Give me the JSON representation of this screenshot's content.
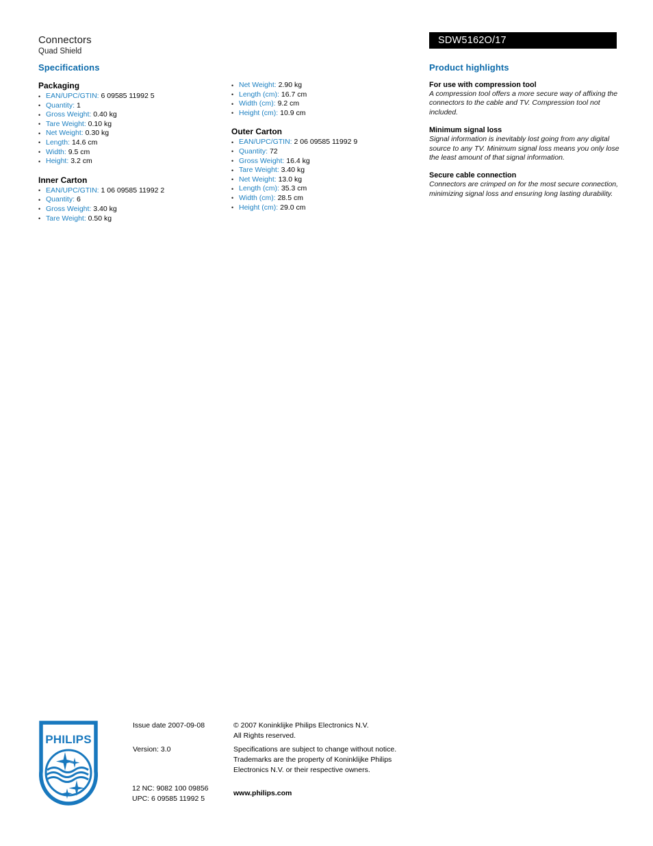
{
  "header": {
    "title": "Connectors",
    "subtitle": "Quad Shield",
    "model": "SDW5162O/17"
  },
  "specifications": {
    "heading": "Specifications",
    "groups": [
      {
        "title": "Packaging",
        "column": "left",
        "items": [
          {
            "label": "EAN/UPC/GTIN:",
            "value": "6 09585 11992 5"
          },
          {
            "label": "Quantity:",
            "value": "1"
          },
          {
            "label": "Gross Weight:",
            "value": "0.40 kg"
          },
          {
            "label": "Tare Weight:",
            "value": "0.10 kg"
          },
          {
            "label": "Net Weight:",
            "value": "0.30 kg"
          },
          {
            "label": "Length:",
            "value": "14.6 cm"
          },
          {
            "label": "Width:",
            "value": "9.5 cm"
          },
          {
            "label": "Height:",
            "value": "3.2 cm"
          }
        ]
      },
      {
        "title": "Inner Carton",
        "column": "left",
        "items": [
          {
            "label": "EAN/UPC/GTIN:",
            "value": "1 06 09585 11992 2"
          },
          {
            "label": "Quantity:",
            "value": "6"
          },
          {
            "label": "Gross Weight:",
            "value": "3.40 kg"
          },
          {
            "label": "Tare Weight:",
            "value": "0.50 kg"
          }
        ]
      },
      {
        "title": "",
        "column": "middle",
        "items": [
          {
            "label": "Net Weight:",
            "value": "2.90 kg"
          },
          {
            "label": "Length (cm):",
            "value": "16.7 cm"
          },
          {
            "label": "Width (cm):",
            "value": "9.2 cm"
          },
          {
            "label": "Height (cm):",
            "value": "10.9 cm"
          }
        ]
      },
      {
        "title": "Outer Carton",
        "column": "middle",
        "items": [
          {
            "label": "EAN/UPC/GTIN:",
            "value": "2 06 09585 11992 9"
          },
          {
            "label": "Quantity:",
            "value": "72"
          },
          {
            "label": "Gross Weight:",
            "value": "16.4 kg"
          },
          {
            "label": "Tare Weight:",
            "value": "3.40 kg"
          },
          {
            "label": "Net Weight:",
            "value": "13.0 kg"
          },
          {
            "label": "Length (cm):",
            "value": "35.3 cm"
          },
          {
            "label": "Width (cm):",
            "value": "28.5 cm"
          },
          {
            "label": "Height (cm):",
            "value": "29.0 cm"
          }
        ]
      }
    ]
  },
  "highlights": {
    "heading": "Product highlights",
    "items": [
      {
        "title": "For use with compression tool",
        "body": "A compression tool offers a more secure way of affixing the connectors to the cable and TV. Compression tool not included."
      },
      {
        "title": "Minimum signal loss",
        "body": "Signal information is inevitably lost going from any digital source to any TV. Minimum signal loss means you only lose the least amount of that signal information."
      },
      {
        "title": "Secure cable connection",
        "body": "Connectors are crimped on for the most secure connection, minimizing signal loss and ensuring long lasting durability."
      }
    ]
  },
  "footer": {
    "logo_text": "PHILIPS",
    "issue_date": "Issue date 2007-09-08",
    "version": "Version: 3.0",
    "twelve_nc": "12 NC: 9082 100 09856",
    "upc": "UPC: 6 09585 11992 5",
    "copyright_line1": "© 2007 Koninklijke Philips Electronics N.V.",
    "copyright_line2": "All Rights reserved.",
    "legal_line1": "Specifications are subject to change without notice.",
    "legal_line2": "Trademarks are the property of Koninklijke Philips",
    "legal_line3": "Electronics N.V. or their respective owners.",
    "website": "www.philips.com"
  },
  "colors": {
    "heading_blue": "#0d6bab",
    "label_blue": "#1a7fc1",
    "philips_blue": "#1878be",
    "model_bar_bg": "#000000"
  }
}
